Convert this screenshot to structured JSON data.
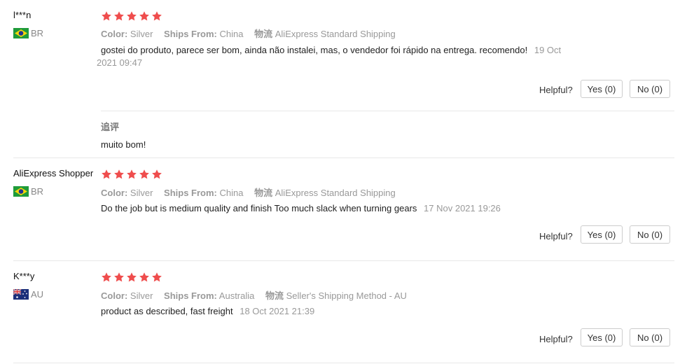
{
  "colors": {
    "star": "#ef4d4d",
    "muted": "#999999"
  },
  "helpful_label": "Helpful?",
  "reviews": [
    {
      "user": "l***n",
      "country": "BR",
      "flag_icon": "brazil-flag-icon",
      "rating": 5,
      "color_label": "Color:",
      "color_value": "Silver",
      "ships_label": "Ships From:",
      "ships_value": "China",
      "logistics_label": "物流",
      "logistics_value": "AliExpress Standard Shipping",
      "text_line1": "gostei do produto, parece ser bom, ainda não instalei, mas, o vendedor foi rápido na entrega. recomendo!",
      "date_part1": "19 Oct",
      "date_part2": "2021 09:47",
      "yes": "Yes (0)",
      "no": "No (0)",
      "followup_label": "追评",
      "followup_text": "muito bom!"
    },
    {
      "user": "AliExpress Shopper",
      "country": "BR",
      "flag_icon": "brazil-flag-icon",
      "rating": 5,
      "color_label": "Color:",
      "color_value": "Silver",
      "ships_label": "Ships From:",
      "ships_value": "China",
      "logistics_label": "物流",
      "logistics_value": "AliExpress Standard Shipping",
      "text": "Do the job but is medium quality and finish Too much slack when turning gears",
      "date": "17 Nov 2021 19:26",
      "yes": "Yes (0)",
      "no": "No (0)"
    },
    {
      "user": "K***y",
      "country": "AU",
      "flag_icon": "australia-flag-icon",
      "rating": 5,
      "color_label": "Color:",
      "color_value": "Silver",
      "ships_label": "Ships From:",
      "ships_value": "Australia",
      "logistics_label": "物流",
      "logistics_value": "Seller's Shipping Method - AU",
      "text": "product as described, fast freight",
      "date": "18 Oct 2021 21:39",
      "yes": "Yes (0)",
      "no": "No (0)"
    }
  ]
}
